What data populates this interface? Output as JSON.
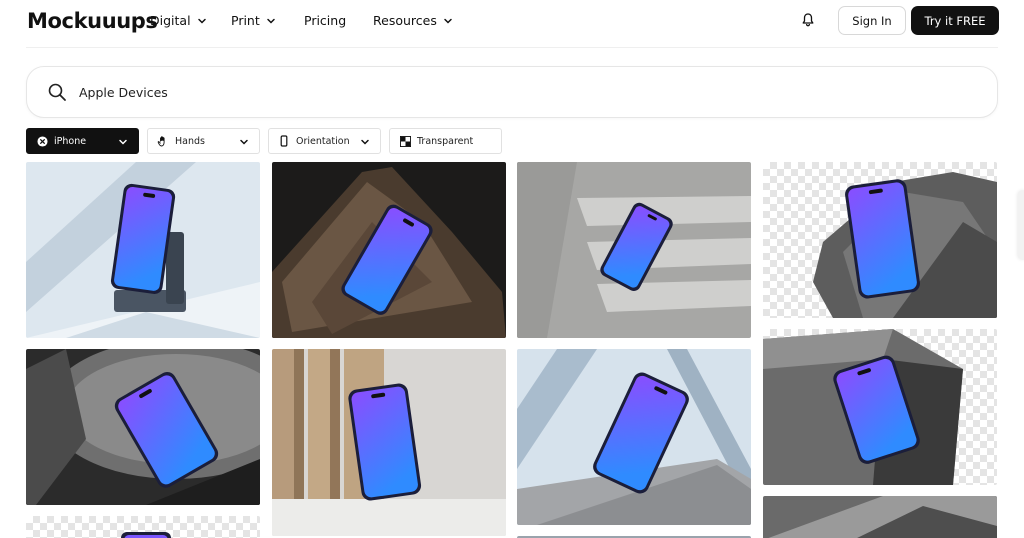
{
  "brand": {
    "logo_text": "Mockuuups"
  },
  "nav": {
    "items": [
      {
        "label": "Digital",
        "has_dropdown": true
      },
      {
        "label": "Print",
        "has_dropdown": true
      },
      {
        "label": "Pricing",
        "has_dropdown": false
      },
      {
        "label": "Resources",
        "has_dropdown": true
      }
    ],
    "notifications_icon": "bell-icon",
    "signin_label": "Sign In",
    "cta_label": "Try it FREE"
  },
  "search": {
    "value": "Apple Devices",
    "placeholder": "",
    "icon": "search-icon"
  },
  "filters": [
    {
      "label": "iPhone",
      "icon": "close-circle-icon",
      "active": true,
      "has_dropdown": true
    },
    {
      "label": "Hands",
      "icon": "hand-icon",
      "active": false,
      "has_dropdown": true
    },
    {
      "label": "Orientation",
      "icon": "phone-orientation-icon",
      "active": false,
      "has_dropdown": true
    },
    {
      "label": "Transparent",
      "icon": "checkerboard-icon",
      "active": false,
      "has_dropdown": false
    }
  ],
  "grid": {
    "columns": 4,
    "cards": [
      {
        "column": 1,
        "scene": "iPhone on wireless charging stand, light blue backdrop"
      },
      {
        "column": 1,
        "scene": "iPhone on gray fabric surface"
      },
      {
        "column": 1,
        "scene": "iPhone mockup on transparent background"
      },
      {
        "column": 2,
        "scene": "iPhone on dark rock"
      },
      {
        "column": 2,
        "scene": "iPhone leaning against wall with wooden panels"
      },
      {
        "column": 3,
        "scene": "iPhone with striped window shadows"
      },
      {
        "column": 3,
        "scene": "iPhone on concrete block, blue shadows"
      },
      {
        "column": 4,
        "scene": "iPhone on gray rock, transparent background"
      },
      {
        "column": 4,
        "scene": "iPhone floating over concrete block, transparent background"
      },
      {
        "column": 4,
        "scene": "Gray concrete surface"
      }
    ]
  },
  "colors": {
    "primary_button_bg": "#111111",
    "screen_gradient_top": "#8a4dff",
    "screen_gradient_bottom": "#2f8bff"
  }
}
